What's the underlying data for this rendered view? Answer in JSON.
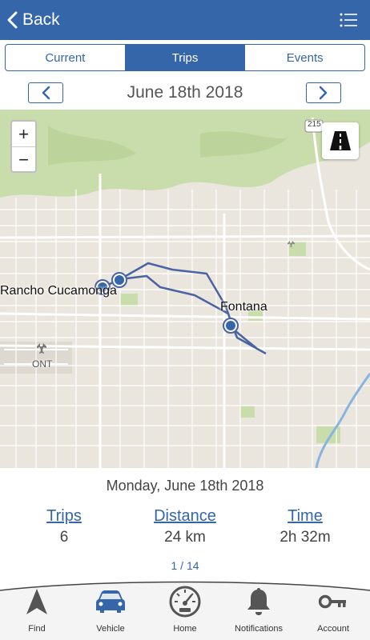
{
  "header": {
    "back_label": "Back"
  },
  "tabs": [
    {
      "label": "Current"
    },
    {
      "label": "Trips",
      "active": true
    },
    {
      "label": "Events"
    }
  ],
  "date_nav": {
    "title": "June 18th 2018"
  },
  "map": {
    "zoom_in": "+",
    "zoom_out": "−",
    "labels": {
      "rancho": "Rancho Cucamonga",
      "fontana": "Fontana",
      "ont": "ONT",
      "hwy": "215"
    }
  },
  "summary": {
    "date": "Monday, June 18th 2018",
    "trips_label": "Trips",
    "trips_value": "6",
    "distance_label": "Distance",
    "distance_value": "24 km",
    "time_label": "Time",
    "time_value": "2h 32m",
    "pager": "1 / 14"
  },
  "bottom_nav": [
    {
      "label": "Find",
      "icon": "navigation-arrow-icon"
    },
    {
      "label": "Vehicle",
      "icon": "car-icon",
      "active": true
    },
    {
      "label": "Home",
      "icon": "speedometer-icon"
    },
    {
      "label": "Notifications",
      "icon": "bell-icon"
    },
    {
      "label": "Account",
      "icon": "key-icon"
    }
  ],
  "colors": {
    "primary": "#3566aa",
    "route": "#4a63a3",
    "map_bg": "#ebe6dd"
  }
}
